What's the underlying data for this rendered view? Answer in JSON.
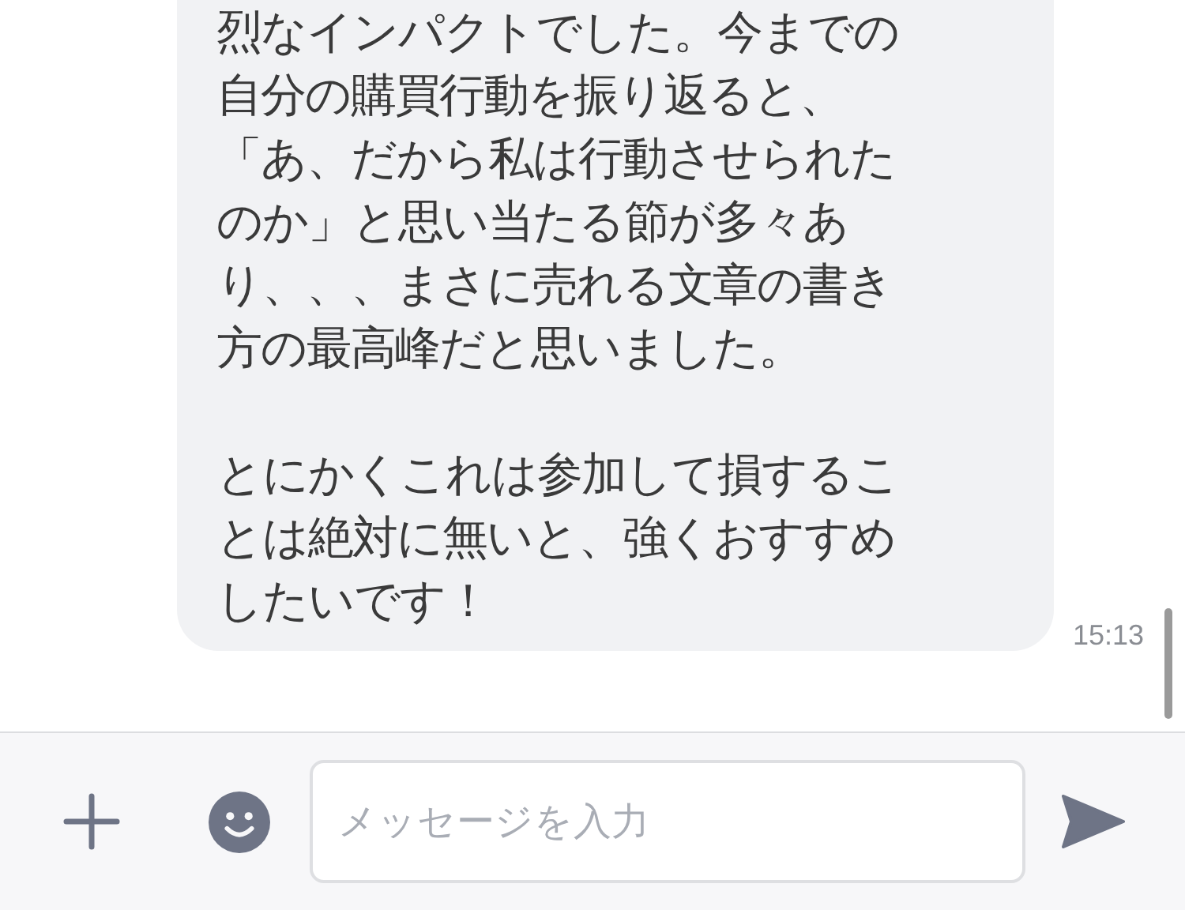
{
  "message": {
    "paragraphs": [
      "烈なインパクトでした。今までの自分の購買行動を振り返ると、「あ、だから私は行動させられたのか」と思い当たる節が多々あり、、、まさに売れる文章の書き方の最高峰だと思いました。",
      "とにかくこれは参加して損することは絶対に無いと、強くおすすめしたいです！"
    ],
    "time": "15:13"
  },
  "composer": {
    "placeholder": "メッセージを入力"
  }
}
